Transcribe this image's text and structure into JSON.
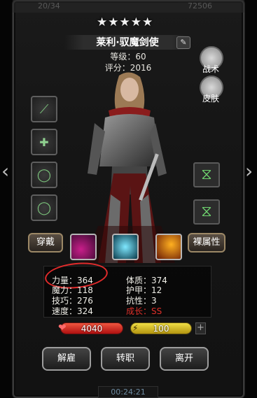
{
  "top_bar": {
    "left_text": "20/34",
    "right_text": "72506"
  },
  "hero": {
    "stars": "★★★★★",
    "name": "莱利·驭魔剑使",
    "level": "等级：60",
    "score": "评分：2016"
  },
  "buttons": {
    "tactics": "战术",
    "skin": "皮肤",
    "wear": "穿戴",
    "naked_attr": "裸属性",
    "dismiss": "解雇",
    "transfer": "转职",
    "leave": "离开"
  },
  "stats": {
    "strength": "力量：364",
    "magic": "魔力：118",
    "skill": "技巧：276",
    "speed": "速度：324",
    "constitution": "体质：374",
    "armor": "护甲：12",
    "resistance": "抗性：3",
    "growth": "成长：SS"
  },
  "bars": {
    "hp": "4040",
    "energy": "100"
  },
  "timer": "00:24:21",
  "colors": {
    "accent_red": "#e12b2b",
    "hp": "#c81e1e",
    "energy": "#e7c51e",
    "growth": "#e0302a"
  }
}
